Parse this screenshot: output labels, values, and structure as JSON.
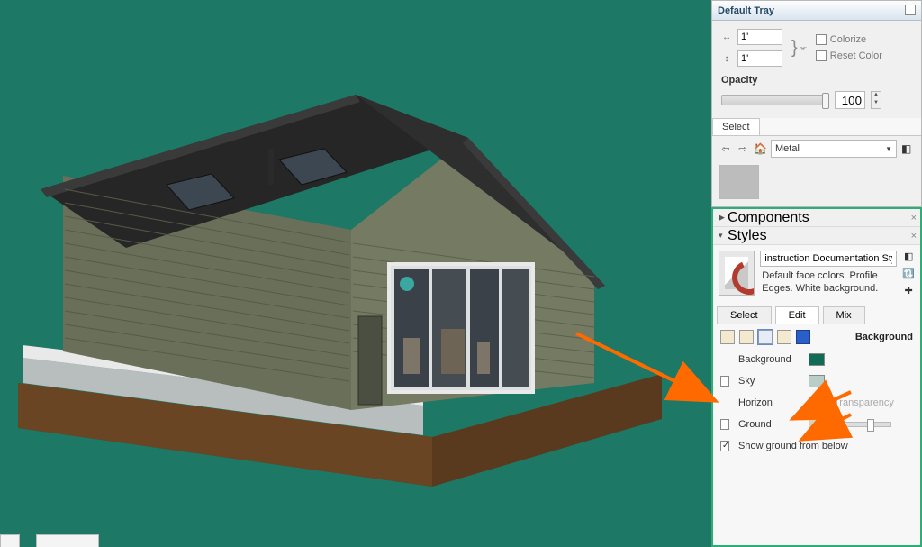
{
  "default_tray": {
    "title": "Default Tray",
    "dim1": "1'",
    "dim2": "1'",
    "colorize": "Colorize",
    "reset_color": "Reset Color",
    "opacity_label": "Opacity",
    "opacity_value": "100",
    "select_tab": "Select",
    "material": "Metal"
  },
  "styles_tray": {
    "components": "Components",
    "styles": "Styles",
    "style_name": "instruction Documentation Style",
    "style_desc": "Default face colors. Profile Edges. White background.",
    "tabs": {
      "select": "Select",
      "edit": "Edit",
      "mix": "Mix"
    },
    "section_label": "Background",
    "rows": {
      "background": "Background",
      "sky": "Sky",
      "horizon": "Horizon",
      "ground": "Ground",
      "show_below": "Show ground from below",
      "transparency": "Transparency"
    },
    "colors": {
      "background": "#116b55",
      "sky": "#b9cec6",
      "horizon": "#ffffff",
      "ground": "#d9d2b6"
    }
  }
}
